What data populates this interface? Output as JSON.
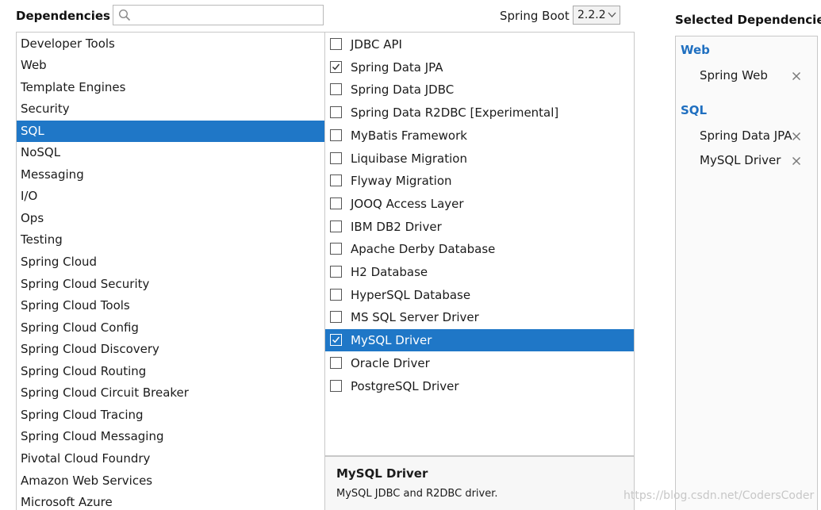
{
  "header": {
    "dependencies_label": "Dependencies",
    "search": {
      "value": "",
      "placeholder": ""
    },
    "spring_boot_label": "Spring Boot",
    "spring_boot_version": "2.2.2"
  },
  "categories": [
    {
      "label": "Developer Tools",
      "selected": false
    },
    {
      "label": "Web",
      "selected": false
    },
    {
      "label": "Template Engines",
      "selected": false
    },
    {
      "label": "Security",
      "selected": false
    },
    {
      "label": "SQL",
      "selected": true
    },
    {
      "label": "NoSQL",
      "selected": false
    },
    {
      "label": "Messaging",
      "selected": false
    },
    {
      "label": "I/O",
      "selected": false
    },
    {
      "label": "Ops",
      "selected": false
    },
    {
      "label": "Testing",
      "selected": false
    },
    {
      "label": "Spring Cloud",
      "selected": false
    },
    {
      "label": "Spring Cloud Security",
      "selected": false
    },
    {
      "label": "Spring Cloud Tools",
      "selected": false
    },
    {
      "label": "Spring Cloud Config",
      "selected": false
    },
    {
      "label": "Spring Cloud Discovery",
      "selected": false
    },
    {
      "label": "Spring Cloud Routing",
      "selected": false
    },
    {
      "label": "Spring Cloud Circuit Breaker",
      "selected": false
    },
    {
      "label": "Spring Cloud Tracing",
      "selected": false
    },
    {
      "label": "Spring Cloud Messaging",
      "selected": false
    },
    {
      "label": "Pivotal Cloud Foundry",
      "selected": false
    },
    {
      "label": "Amazon Web Services",
      "selected": false
    },
    {
      "label": "Microsoft Azure",
      "selected": false
    }
  ],
  "dependencies": [
    {
      "label": "JDBC API",
      "checked": false,
      "selected": false
    },
    {
      "label": "Spring Data JPA",
      "checked": true,
      "selected": false
    },
    {
      "label": "Spring Data JDBC",
      "checked": false,
      "selected": false
    },
    {
      "label": "Spring Data R2DBC [Experimental]",
      "checked": false,
      "selected": false
    },
    {
      "label": "MyBatis Framework",
      "checked": false,
      "selected": false
    },
    {
      "label": "Liquibase Migration",
      "checked": false,
      "selected": false
    },
    {
      "label": "Flyway Migration",
      "checked": false,
      "selected": false
    },
    {
      "label": "JOOQ Access Layer",
      "checked": false,
      "selected": false
    },
    {
      "label": "IBM DB2 Driver",
      "checked": false,
      "selected": false
    },
    {
      "label": "Apache Derby Database",
      "checked": false,
      "selected": false
    },
    {
      "label": "H2 Database",
      "checked": false,
      "selected": false
    },
    {
      "label": "HyperSQL Database",
      "checked": false,
      "selected": false
    },
    {
      "label": "MS SQL Server Driver",
      "checked": false,
      "selected": false
    },
    {
      "label": "MySQL Driver",
      "checked": true,
      "selected": true
    },
    {
      "label": "Oracle Driver",
      "checked": false,
      "selected": false
    },
    {
      "label": "PostgreSQL Driver",
      "checked": false,
      "selected": false
    }
  ],
  "description": {
    "title": "MySQL Driver",
    "text": "MySQL JDBC and R2DBC driver."
  },
  "selected_panel": {
    "title": "Selected Dependencies",
    "groups": [
      {
        "name": "Web",
        "items": [
          "Spring Web"
        ]
      },
      {
        "name": "SQL",
        "items": [
          "Spring Data JPA",
          "MySQL Driver"
        ]
      }
    ]
  },
  "watermark": "https://blog.csdn.net/CodersCoder",
  "colors": {
    "selection": "#1f77c7",
    "group_heading": "#1f6fc0"
  }
}
